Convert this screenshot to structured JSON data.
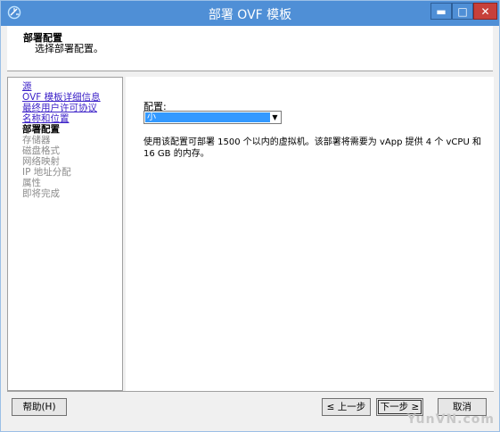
{
  "window": {
    "title": "部署 OVF 模板",
    "min_glyph": "▬",
    "max_glyph": "□",
    "close_glyph": "✕"
  },
  "header": {
    "title": "部署配置",
    "subtitle": "选择部署配置。"
  },
  "nav": [
    {
      "label": "源",
      "state": "link"
    },
    {
      "label": "OVF 模板详细信息",
      "state": "link"
    },
    {
      "label": "最终用户许可协议",
      "state": "link"
    },
    {
      "label": "名称和位置",
      "state": "link"
    },
    {
      "label": "部署配置",
      "state": "current"
    },
    {
      "label": "存储器",
      "state": "disabled"
    },
    {
      "label": "磁盘格式",
      "state": "disabled"
    },
    {
      "label": "网络映射",
      "state": "disabled"
    },
    {
      "label": "IP 地址分配",
      "state": "disabled"
    },
    {
      "label": "属性",
      "state": "disabled"
    },
    {
      "label": "即将完成",
      "state": "disabled"
    }
  ],
  "config": {
    "label": "配置:",
    "selected": "小",
    "description": "使用该配置可部署 1500 个以内的虚拟机。该部署将需要为 vApp 提供 4 个 vCPU 和 16 GB 的内存。"
  },
  "buttons": {
    "help": "帮助(H)",
    "back": "≤ 上一步",
    "next": "下一步 ≥",
    "cancel": "取消"
  },
  "watermark": "YunVN.com",
  "colors": {
    "titlebar": "#4f8fd6",
    "link": "#3c22c8",
    "selection": "#3399ff"
  }
}
